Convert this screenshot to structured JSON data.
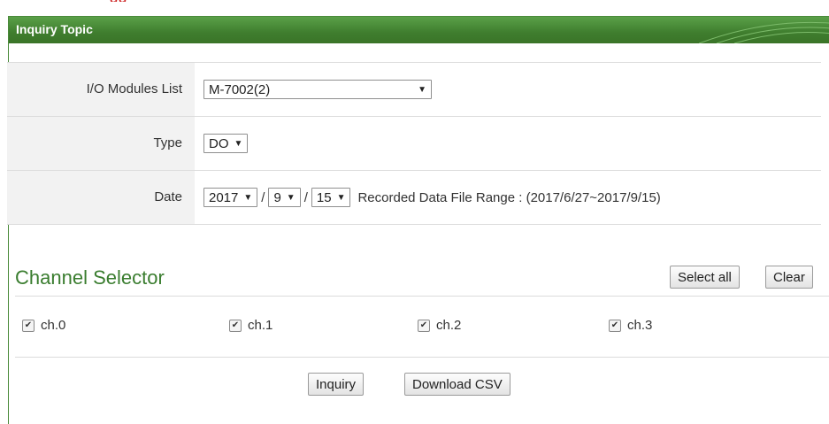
{
  "top_fragment": "gg",
  "panel": {
    "title": "Inquiry Topic"
  },
  "form": {
    "io_modules": {
      "label": "I/O Modules List",
      "value": "M-7002(2)"
    },
    "type": {
      "label": "Type",
      "value": "DO"
    },
    "date": {
      "label": "Date",
      "year": "2017",
      "month": "9",
      "day": "15",
      "separator": "/",
      "range_text": "Recorded Data File Range : (2017/6/27~2017/9/15)"
    }
  },
  "channel_selector": {
    "title": "Channel Selector",
    "select_all_label": "Select all",
    "clear_label": "Clear",
    "channels": [
      {
        "label": "ch.0",
        "checked": true
      },
      {
        "label": "ch.1",
        "checked": true
      },
      {
        "label": "ch.2",
        "checked": true
      },
      {
        "label": "ch.3",
        "checked": true
      }
    ]
  },
  "actions": {
    "inquiry_label": "Inquiry",
    "download_label": "Download CSV"
  },
  "colors": {
    "header_green": "#3f7d2e",
    "title_green": "#3a7d2f",
    "label_bg": "#f2f2f2"
  }
}
